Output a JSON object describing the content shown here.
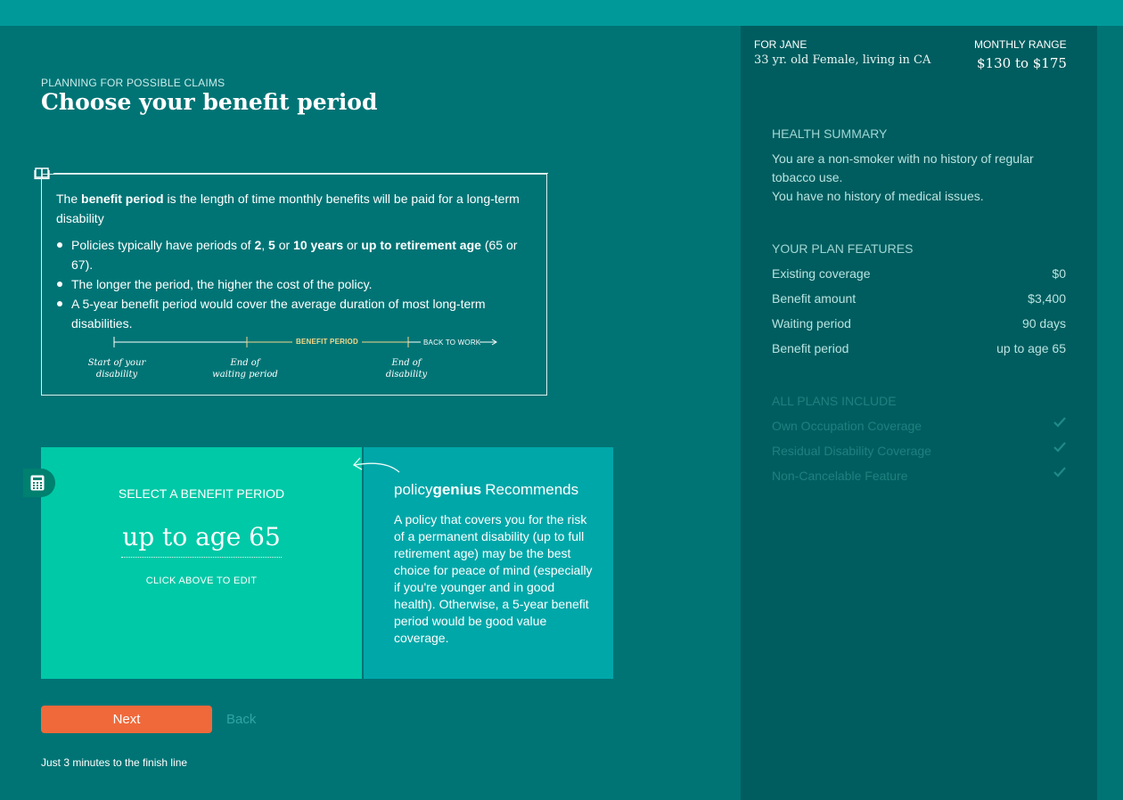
{
  "colors": {
    "top_bar": "#009999",
    "main_bg": "#007475",
    "sidebar_bg": "#005d5f",
    "select_panel": "#00c9a7",
    "recommend_panel": "#00a7a9",
    "next_button": "#f0693a",
    "timeline_highlight": "#f3d98a"
  },
  "header": {
    "eyebrow": "PLANNING FOR POSSIBLE CLAIMS",
    "title": "Choose your benefit period"
  },
  "info": {
    "icon": "book-icon",
    "intro_before": "The ",
    "intro_bold": "benefit period",
    "intro_after": " is the length of time monthly benefits will be paid for a long-term disability",
    "bullet1": {
      "t1": "Policies typically have periods of ",
      "b1": "2",
      "t2": ", ",
      "b2": "5",
      "t3": " or ",
      "b3": "10 years",
      "t4": " or ",
      "b4": "up to retirement age",
      "t5": " (65 or 67)."
    },
    "bullet2": "The longer the period, the higher the cost of the policy.",
    "bullet3": "A 5-year benefit period would cover the average duration of most long-term disabilities."
  },
  "timeline": {
    "benefit_period": "BENEFIT PERIOD",
    "back_to_work": "BACK TO WORK",
    "start_line1": "Start of your",
    "start_line2": "disability",
    "wait_line1": "End of",
    "wait_line2": "waiting period",
    "end_line1": "End of",
    "end_line2": "disability"
  },
  "selector": {
    "icon": "calculator-icon",
    "title": "SELECT A BENEFIT PERIOD",
    "value": "up to age 65",
    "hint": "CLICK ABOVE TO EDIT"
  },
  "recommend": {
    "brand_regular": "policy",
    "brand_bold": "genius",
    "heading": "Recommends",
    "text": "A policy that covers you for the risk of a permanent disability (up to full retirement age) may be the best choice for peace of mind (especially if you're younger and in good health). Otherwise, a 5-year benefit period would be good value coverage."
  },
  "actions": {
    "next": "Next",
    "back": "Back",
    "finish_note": "Just 3 minutes to the finish line"
  },
  "sidebar": {
    "for_label": "FOR JANE",
    "user_desc": "33 yr. old Female, living in CA",
    "range_label": "MONTHLY RANGE",
    "range_value": "$130 to $175",
    "health_title": "HEALTH SUMMARY",
    "health_line1": "You are a non-smoker with no history of regular tobacco use.",
    "health_line2": "You have no history of medical issues.",
    "features_title": "YOUR PLAN FEATURES",
    "features": [
      {
        "label": "Existing coverage",
        "value": "$0"
      },
      {
        "label": "Benefit amount",
        "value": "$3,400"
      },
      {
        "label": "Waiting period",
        "value": "90 days"
      },
      {
        "label": "Benefit period",
        "value": "up to age 65"
      }
    ],
    "includes_title": "ALL PLANS INCLUDE",
    "includes": [
      {
        "label": "Own Occupation Coverage",
        "icon": "check-icon"
      },
      {
        "label": "Residual Disability Coverage",
        "icon": "check-icon"
      },
      {
        "label": "Non-Cancelable Feature",
        "icon": "check-icon"
      }
    ]
  }
}
